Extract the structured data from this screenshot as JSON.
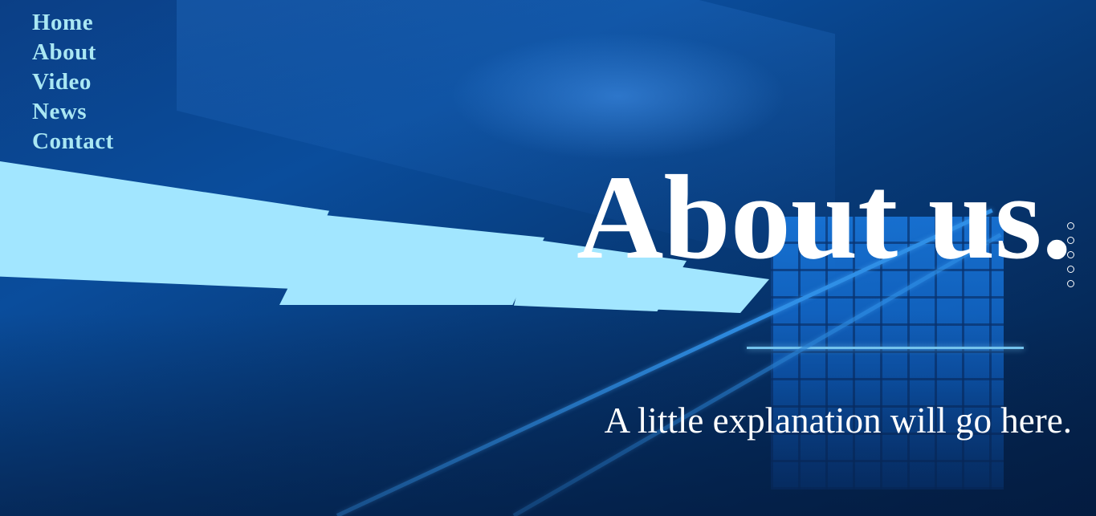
{
  "nav": {
    "items": [
      {
        "label": "Home"
      },
      {
        "label": "About"
      },
      {
        "label": "Video"
      },
      {
        "label": "News"
      },
      {
        "label": "Contact"
      }
    ]
  },
  "hero": {
    "headline": "About us.",
    "subline": "A little explanation will go here.",
    "background_image": "blue-tinted-corridor-photo"
  },
  "pager": {
    "dot_count": 5,
    "active_index": null
  },
  "colors": {
    "nav_text": "#a9e7f3",
    "headline_text": "#ffffff",
    "background_tint": "#0a4d9c"
  }
}
